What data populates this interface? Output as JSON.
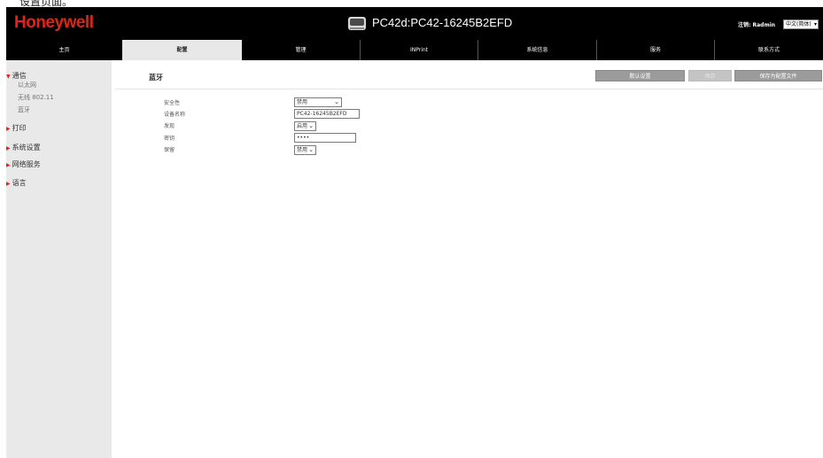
{
  "top_fragment": "设置页面。",
  "header": {
    "logo": "Honeywell",
    "device_title": "PC42d:PC42-16245B2EFD",
    "logout": "注销: Radmin",
    "language": "中文(简体)"
  },
  "nav": {
    "tabs": [
      "主页",
      "配置",
      "管理",
      "INPrint",
      "系统信息",
      "服务",
      "联系方式"
    ],
    "active_tab": "配置"
  },
  "sidebar": {
    "communication": {
      "label": "通信",
      "subitems": [
        "以太网",
        "无线 802.11",
        "蓝牙"
      ]
    },
    "items": [
      "打印",
      "系统设置",
      "网络服务",
      "语言"
    ]
  },
  "content": {
    "title": "蓝牙",
    "buttons": {
      "default_settings": "默认设置",
      "save": "保存",
      "save_as_config": "保存为配置文件"
    },
    "fields": [
      {
        "label": "安全性",
        "value": "禁用",
        "type": "select"
      },
      {
        "label": "设备名称",
        "value": "PC42-16245B2EFD",
        "type": "text"
      },
      {
        "label": "发现",
        "value": "启用",
        "type": "select"
      },
      {
        "label": "密钥",
        "value": "••••",
        "type": "password"
      },
      {
        "label": "保留",
        "value": "禁用",
        "type": "select"
      }
    ]
  },
  "colors": {
    "accent_red": "#e2231a",
    "header_bg": "#000000",
    "sidebar_bg": "#e9e9e9",
    "button_gray": "#9b9b9b"
  }
}
